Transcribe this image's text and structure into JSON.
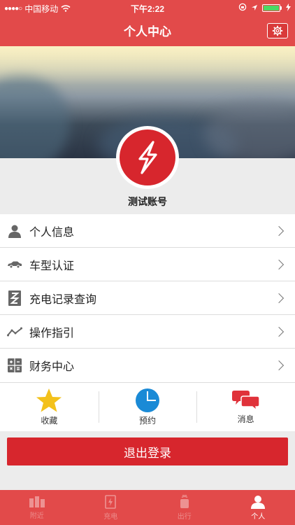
{
  "status_bar": {
    "carrier": "中国移动",
    "time": "下午2:22"
  },
  "nav": {
    "title": "个人中心",
    "settings_icon": "gear-icon"
  },
  "profile": {
    "account_name": "测试账号"
  },
  "menu": [
    {
      "label": "个人信息",
      "icon": "user-icon"
    },
    {
      "label": "车型认证",
      "icon": "car-icon"
    },
    {
      "label": "充电记录查询",
      "icon": "charge-record-icon"
    },
    {
      "label": "操作指引",
      "icon": "trend-icon"
    },
    {
      "label": "财务中心",
      "icon": "calculator-icon"
    }
  ],
  "quick_actions": [
    {
      "label": "收藏",
      "icon": "star-icon"
    },
    {
      "label": "预约",
      "icon": "clock-icon"
    },
    {
      "label": "消息",
      "icon": "chat-icon"
    }
  ],
  "logout_label": "退出登录",
  "tabbar": [
    {
      "label": "附近",
      "icon": "stations-icon",
      "active": false
    },
    {
      "label": "充电",
      "icon": "charging-icon",
      "active": false
    },
    {
      "label": "出行",
      "icon": "travel-icon",
      "active": false
    },
    {
      "label": "个人",
      "icon": "person-icon",
      "active": true
    }
  ],
  "colors": {
    "brand": "#e24a4a",
    "logout": "#d7262d",
    "star": "#f3c11b",
    "clock": "#1a8ad6",
    "chat": "#e0323a"
  }
}
